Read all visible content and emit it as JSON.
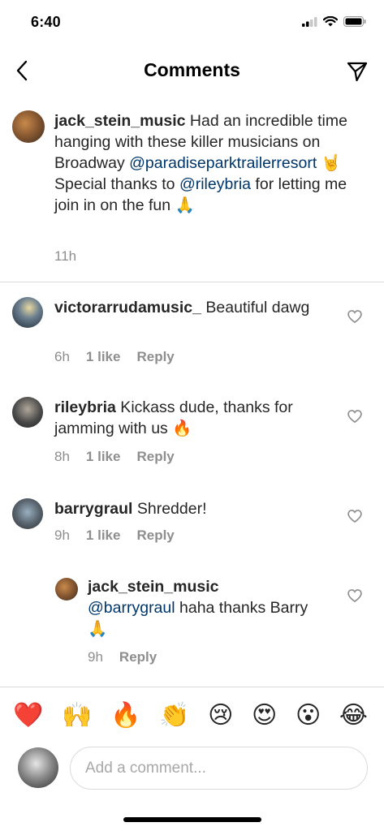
{
  "status_bar": {
    "time": "6:40"
  },
  "header": {
    "title": "Comments",
    "back_icon": "chevron-left-icon",
    "send_icon": "paper-plane-icon"
  },
  "caption": {
    "username": "jack_stein_music",
    "text_part1": " Had an incredible time hanging with these killer musicians on Broadway ",
    "mention1": "@paradiseparktrailerresort",
    "text_part2": " 🤘 Special thanks to ",
    "mention2": "@rileybria",
    "text_part3": " for letting me join in on the fun 🙏",
    "time": "11h"
  },
  "comments": [
    {
      "username": "victorarrudamusic_",
      "text": " Beautiful dawg",
      "time": "6h",
      "likes": "1 like",
      "reply_label": "Reply"
    },
    {
      "username": "rileybria",
      "text": " Kickass dude, thanks for jamming with us 🔥",
      "time": "8h",
      "likes": "1 like",
      "reply_label": "Reply"
    },
    {
      "username": "barrygraul",
      "text": " Shredder!",
      "time": "9h",
      "likes": "1 like",
      "reply_label": "Reply"
    }
  ],
  "reply": {
    "username": "jack_stein_music",
    "mention": "@barrygraul",
    "text": " haha thanks Barry 🙏",
    "time": "9h",
    "reply_label": "Reply"
  },
  "emoji_bar": [
    "❤️",
    "🙌",
    "🔥",
    "👏",
    "😢",
    "😍",
    "😮",
    "😂"
  ],
  "composer": {
    "placeholder": "Add a comment..."
  },
  "colors": {
    "text": "#262626",
    "meta": "#8e8e8e",
    "mention": "#00376b",
    "divider": "#dbdbdb"
  }
}
